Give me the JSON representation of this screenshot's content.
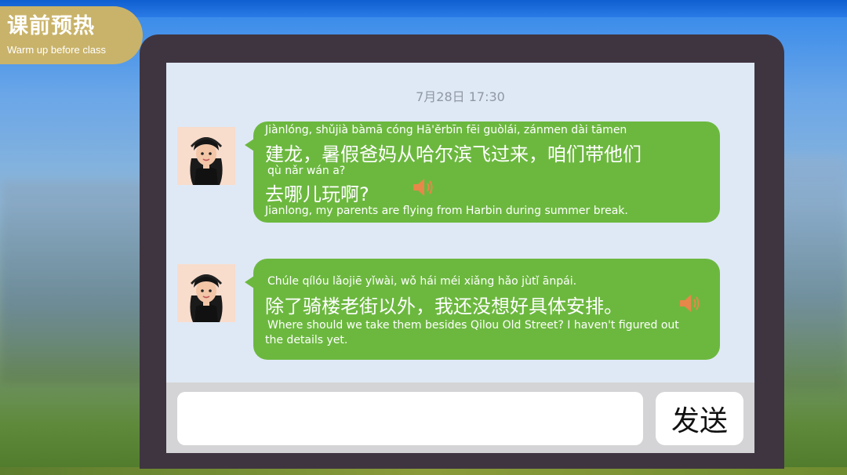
{
  "header": {
    "title": "课前预热",
    "subtitle": "Warm up before class"
  },
  "chat": {
    "timestamp": "7月28日 17:30",
    "messages": [
      {
        "pinyin_1": "Jiànlóng, shǔjià bàmā cóng Hā'ěrbīn fēi guòlái, zánmen dài tāmen",
        "hanzi_1": "建龙，暑假爸妈从哈尔滨飞过来，咱们带他们",
        "pinyin_2": "qù nǎr wán a?",
        "hanzi_2": "去哪儿玩啊?",
        "english": "Jianlong, my parents are flying from Harbin during summer break."
      },
      {
        "pinyin_1": "Chúle qílóu lǎojiē yǐwài, wǒ hái méi xiǎng hǎo jùtǐ ānpái.",
        "hanzi_1": "除了骑楼老街以外，我还没想好具体安排。",
        "english": "Where should we take them besides Qilou Old Street? I haven't figured out the details yet."
      }
    ]
  },
  "composer": {
    "input_value": "",
    "send_label": "发送"
  },
  "icons": {
    "avatar": "girl-avatar-icon",
    "audio": "speaker-icon"
  },
  "colors": {
    "bubble": "#6cb83f",
    "speaker": "#e8874a",
    "badge": "#c9b36a",
    "device": "#3f3540",
    "screen": "#dfe9f5"
  }
}
